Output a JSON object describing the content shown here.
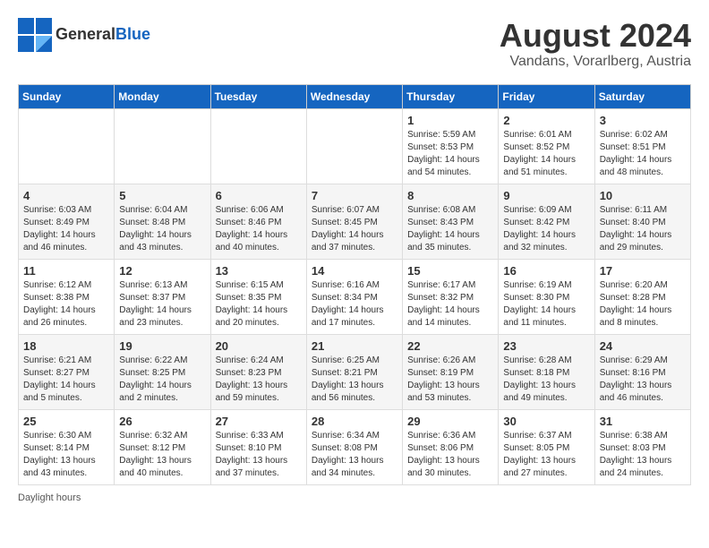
{
  "header": {
    "logo_general": "General",
    "logo_blue": "Blue",
    "month_year": "August 2024",
    "location": "Vandans, Vorarlberg, Austria"
  },
  "days_of_week": [
    "Sunday",
    "Monday",
    "Tuesday",
    "Wednesday",
    "Thursday",
    "Friday",
    "Saturday"
  ],
  "weeks": [
    [
      {
        "day": "",
        "info": ""
      },
      {
        "day": "",
        "info": ""
      },
      {
        "day": "",
        "info": ""
      },
      {
        "day": "",
        "info": ""
      },
      {
        "day": "1",
        "info": "Sunrise: 5:59 AM\nSunset: 8:53 PM\nDaylight: 14 hours\nand 54 minutes."
      },
      {
        "day": "2",
        "info": "Sunrise: 6:01 AM\nSunset: 8:52 PM\nDaylight: 14 hours\nand 51 minutes."
      },
      {
        "day": "3",
        "info": "Sunrise: 6:02 AM\nSunset: 8:51 PM\nDaylight: 14 hours\nand 48 minutes."
      }
    ],
    [
      {
        "day": "4",
        "info": "Sunrise: 6:03 AM\nSunset: 8:49 PM\nDaylight: 14 hours\nand 46 minutes."
      },
      {
        "day": "5",
        "info": "Sunrise: 6:04 AM\nSunset: 8:48 PM\nDaylight: 14 hours\nand 43 minutes."
      },
      {
        "day": "6",
        "info": "Sunrise: 6:06 AM\nSunset: 8:46 PM\nDaylight: 14 hours\nand 40 minutes."
      },
      {
        "day": "7",
        "info": "Sunrise: 6:07 AM\nSunset: 8:45 PM\nDaylight: 14 hours\nand 37 minutes."
      },
      {
        "day": "8",
        "info": "Sunrise: 6:08 AM\nSunset: 8:43 PM\nDaylight: 14 hours\nand 35 minutes."
      },
      {
        "day": "9",
        "info": "Sunrise: 6:09 AM\nSunset: 8:42 PM\nDaylight: 14 hours\nand 32 minutes."
      },
      {
        "day": "10",
        "info": "Sunrise: 6:11 AM\nSunset: 8:40 PM\nDaylight: 14 hours\nand 29 minutes."
      }
    ],
    [
      {
        "day": "11",
        "info": "Sunrise: 6:12 AM\nSunset: 8:38 PM\nDaylight: 14 hours\nand 26 minutes."
      },
      {
        "day": "12",
        "info": "Sunrise: 6:13 AM\nSunset: 8:37 PM\nDaylight: 14 hours\nand 23 minutes."
      },
      {
        "day": "13",
        "info": "Sunrise: 6:15 AM\nSunset: 8:35 PM\nDaylight: 14 hours\nand 20 minutes."
      },
      {
        "day": "14",
        "info": "Sunrise: 6:16 AM\nSunset: 8:34 PM\nDaylight: 14 hours\nand 17 minutes."
      },
      {
        "day": "15",
        "info": "Sunrise: 6:17 AM\nSunset: 8:32 PM\nDaylight: 14 hours\nand 14 minutes."
      },
      {
        "day": "16",
        "info": "Sunrise: 6:19 AM\nSunset: 8:30 PM\nDaylight: 14 hours\nand 11 minutes."
      },
      {
        "day": "17",
        "info": "Sunrise: 6:20 AM\nSunset: 8:28 PM\nDaylight: 14 hours\nand 8 minutes."
      }
    ],
    [
      {
        "day": "18",
        "info": "Sunrise: 6:21 AM\nSunset: 8:27 PM\nDaylight: 14 hours\nand 5 minutes."
      },
      {
        "day": "19",
        "info": "Sunrise: 6:22 AM\nSunset: 8:25 PM\nDaylight: 14 hours\nand 2 minutes."
      },
      {
        "day": "20",
        "info": "Sunrise: 6:24 AM\nSunset: 8:23 PM\nDaylight: 13 hours\nand 59 minutes."
      },
      {
        "day": "21",
        "info": "Sunrise: 6:25 AM\nSunset: 8:21 PM\nDaylight: 13 hours\nand 56 minutes."
      },
      {
        "day": "22",
        "info": "Sunrise: 6:26 AM\nSunset: 8:19 PM\nDaylight: 13 hours\nand 53 minutes."
      },
      {
        "day": "23",
        "info": "Sunrise: 6:28 AM\nSunset: 8:18 PM\nDaylight: 13 hours\nand 49 minutes."
      },
      {
        "day": "24",
        "info": "Sunrise: 6:29 AM\nSunset: 8:16 PM\nDaylight: 13 hours\nand 46 minutes."
      }
    ],
    [
      {
        "day": "25",
        "info": "Sunrise: 6:30 AM\nSunset: 8:14 PM\nDaylight: 13 hours\nand 43 minutes."
      },
      {
        "day": "26",
        "info": "Sunrise: 6:32 AM\nSunset: 8:12 PM\nDaylight: 13 hours\nand 40 minutes."
      },
      {
        "day": "27",
        "info": "Sunrise: 6:33 AM\nSunset: 8:10 PM\nDaylight: 13 hours\nand 37 minutes."
      },
      {
        "day": "28",
        "info": "Sunrise: 6:34 AM\nSunset: 8:08 PM\nDaylight: 13 hours\nand 34 minutes."
      },
      {
        "day": "29",
        "info": "Sunrise: 6:36 AM\nSunset: 8:06 PM\nDaylight: 13 hours\nand 30 minutes."
      },
      {
        "day": "30",
        "info": "Sunrise: 6:37 AM\nSunset: 8:05 PM\nDaylight: 13 hours\nand 27 minutes."
      },
      {
        "day": "31",
        "info": "Sunrise: 6:38 AM\nSunset: 8:03 PM\nDaylight: 13 hours\nand 24 minutes."
      }
    ]
  ],
  "footer": {
    "note": "Daylight hours"
  },
  "colors": {
    "header_bg": "#1565c0",
    "header_text": "#ffffff",
    "accent": "#1565c0"
  }
}
